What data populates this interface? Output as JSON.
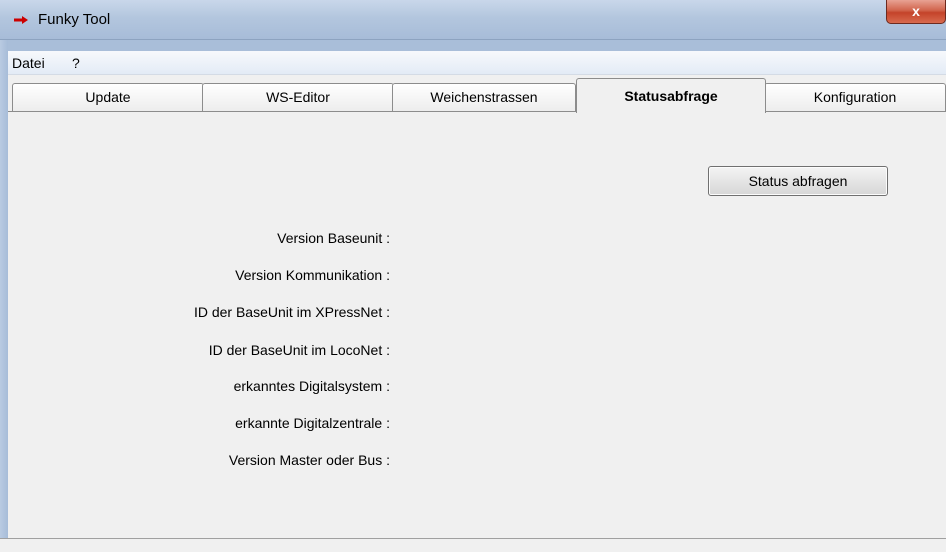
{
  "window": {
    "title": "Funky Tool",
    "close_symbol": "x",
    "app_icon": "red-arrow-icon",
    "accent": "#cc0000"
  },
  "menu": {
    "items": [
      "Datei",
      "?"
    ]
  },
  "tabs": {
    "items": [
      {
        "label": "Update"
      },
      {
        "label": "WS-Editor"
      },
      {
        "label": "Weichenstrassen"
      },
      {
        "label": "Statusabfrage"
      },
      {
        "label": "Konfiguration"
      }
    ],
    "active": "Statusabfrage"
  },
  "status": {
    "button_label": "Status abfragen",
    "fields": [
      {
        "label": "Version Baseunit :"
      },
      {
        "label": "Version Kommunikation :"
      },
      {
        "label": "ID der BaseUnit im XPressNet :"
      },
      {
        "label": "ID der BaseUnit im LocoNet :"
      },
      {
        "label": "erkanntes Digitalsystem :"
      },
      {
        "label": "erkannte Digitalzentrale :"
      },
      {
        "label": "Version Master oder Bus :"
      }
    ]
  }
}
